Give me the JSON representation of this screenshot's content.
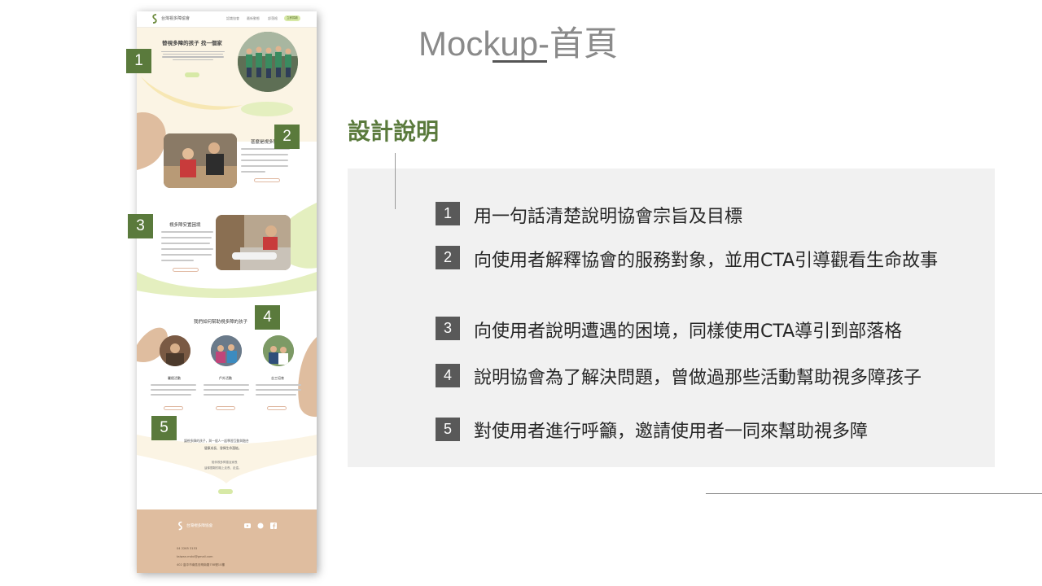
{
  "slide": {
    "title": "Mockup-首頁",
    "section_heading": "設計說明"
  },
  "badges": [
    "1",
    "2",
    "3",
    "4",
    "5"
  ],
  "items": [
    {
      "number": "1",
      "text": "用一句話清楚說明協會宗旨及目標"
    },
    {
      "number": "2",
      "text": "向使用者解釋協會的服務對象，並用CTA引導觀看生命故事"
    },
    {
      "number": "3",
      "text": "向使用者說明遭遇的困境，同樣使用CTA導引到部落格"
    },
    {
      "number": "4",
      "text": "說明協會為了解決問題，曾做過那些活動幫助視多障孩子"
    },
    {
      "number": "5",
      "text": "對使用者進行呼籲，邀請使用者一同來幫助視多障"
    }
  ],
  "mockup": {
    "brand": "台灣視多障協會",
    "nav": [
      "認識協會",
      "最新動態",
      "部落格"
    ],
    "nav_button": "立即捐款",
    "hero_title": "替視多障的孩子 找一個家",
    "section2_title": "甚麼是視多障",
    "section3_title": "視多障安置困境",
    "section4_title": "我們如何幫助視多障的孩子",
    "activities": [
      "暑假活動",
      "戶外活動",
      "志工培育"
    ],
    "cta_text_line1": "讓視多障的孩子，與一般人一起學習互動與融合",
    "cta_text_line2": "健康成長、發揮生命潛能。",
    "cta_text_line3": "陪伴視多障童及家長",
    "cta_text_line4": "這條艱難的路上走長、走遠。",
    "footer_phone": "04 2265 3153",
    "footer_email": "taiwan.mdvi@gmail.com",
    "footer_address": "402 臺中市南區忠明南路758號10樓"
  },
  "colors": {
    "accent_green": "#5a7a3c",
    "badge_gray": "#595959",
    "panel_bg": "#f1f1f1",
    "mock_cream": "#fbf4e4",
    "mock_tan": "#dfbd9f",
    "mock_lime": "#e4efbf"
  }
}
